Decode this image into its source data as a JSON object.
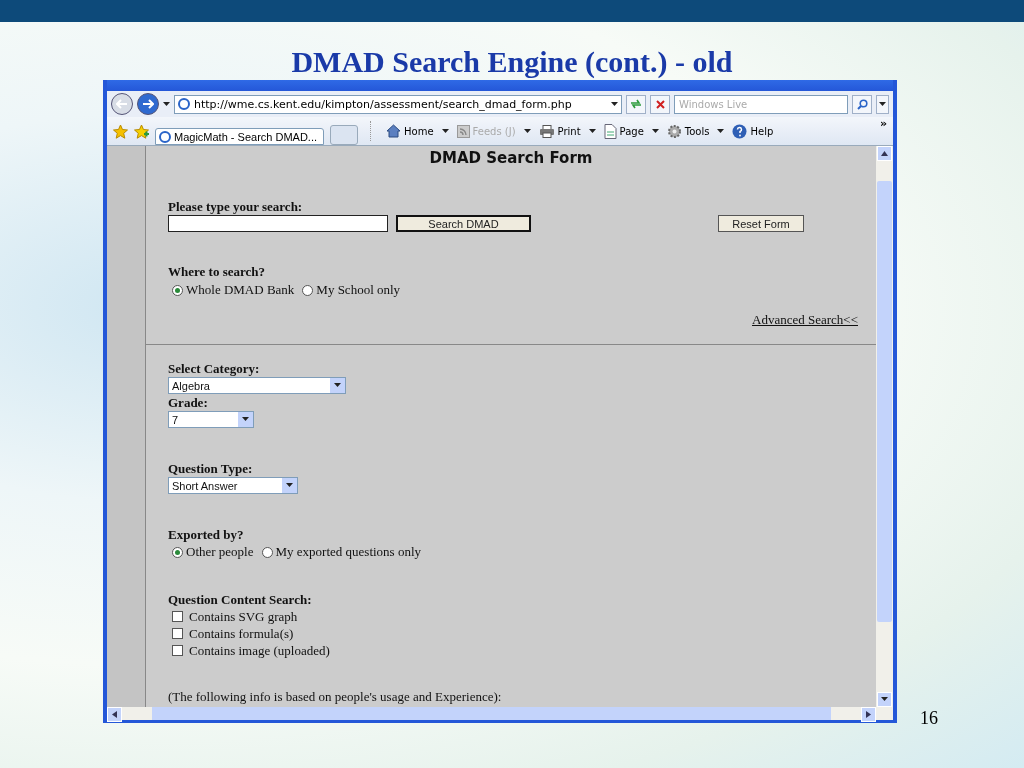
{
  "slide": {
    "title": "DMAD Search Engine (cont.) - old",
    "page_number": "16"
  },
  "browser": {
    "address": "http://wme.cs.kent.edu/kimpton/assessment/search_dmad_form.php",
    "search_placeholder": "Windows Live",
    "tabs": [
      {
        "label": "MagicMath - Search DMAD...",
        "selected": true
      }
    ],
    "toolbar": [
      {
        "label": "Home",
        "disabled": false
      },
      {
        "label": "Feeds (J)",
        "disabled": true
      },
      {
        "label": "Print",
        "disabled": false
      },
      {
        "label": "Page",
        "disabled": false
      },
      {
        "label": "Tools",
        "disabled": false
      },
      {
        "label": "Help",
        "disabled": false
      }
    ],
    "chevron": "»"
  },
  "form": {
    "heading": "DMAD Search Form",
    "search_label": "Please type your search:",
    "buttons": [
      {
        "label": "Search DMAD"
      },
      {
        "label": "Reset Form"
      }
    ],
    "where_label": "Where to search?",
    "where_options": [
      {
        "label": "Whole DMAD Bank",
        "selected": true
      },
      {
        "label": "My School only",
        "selected": false
      }
    ],
    "advanced_link": "Advanced Search<<",
    "category_label": "Select Category:",
    "category_value": "Algebra",
    "grade_label": "Grade:",
    "grade_value": "7",
    "type_label": "Question Type:",
    "type_value": "Short Answer",
    "exported_label": "Exported by?",
    "exported_options": [
      {
        "label": "Other people",
        "selected": true
      },
      {
        "label": "My exported questions only",
        "selected": false
      }
    ],
    "content_label": "Question Content Search:",
    "content_options": [
      {
        "label": "Contains SVG graph",
        "checked": false
      },
      {
        "label": "Contains formula(s)",
        "checked": false
      },
      {
        "label": "Contains image (uploaded)",
        "checked": false
      }
    ],
    "footnote": "(The following info is based on people's usage and Experience):"
  }
}
